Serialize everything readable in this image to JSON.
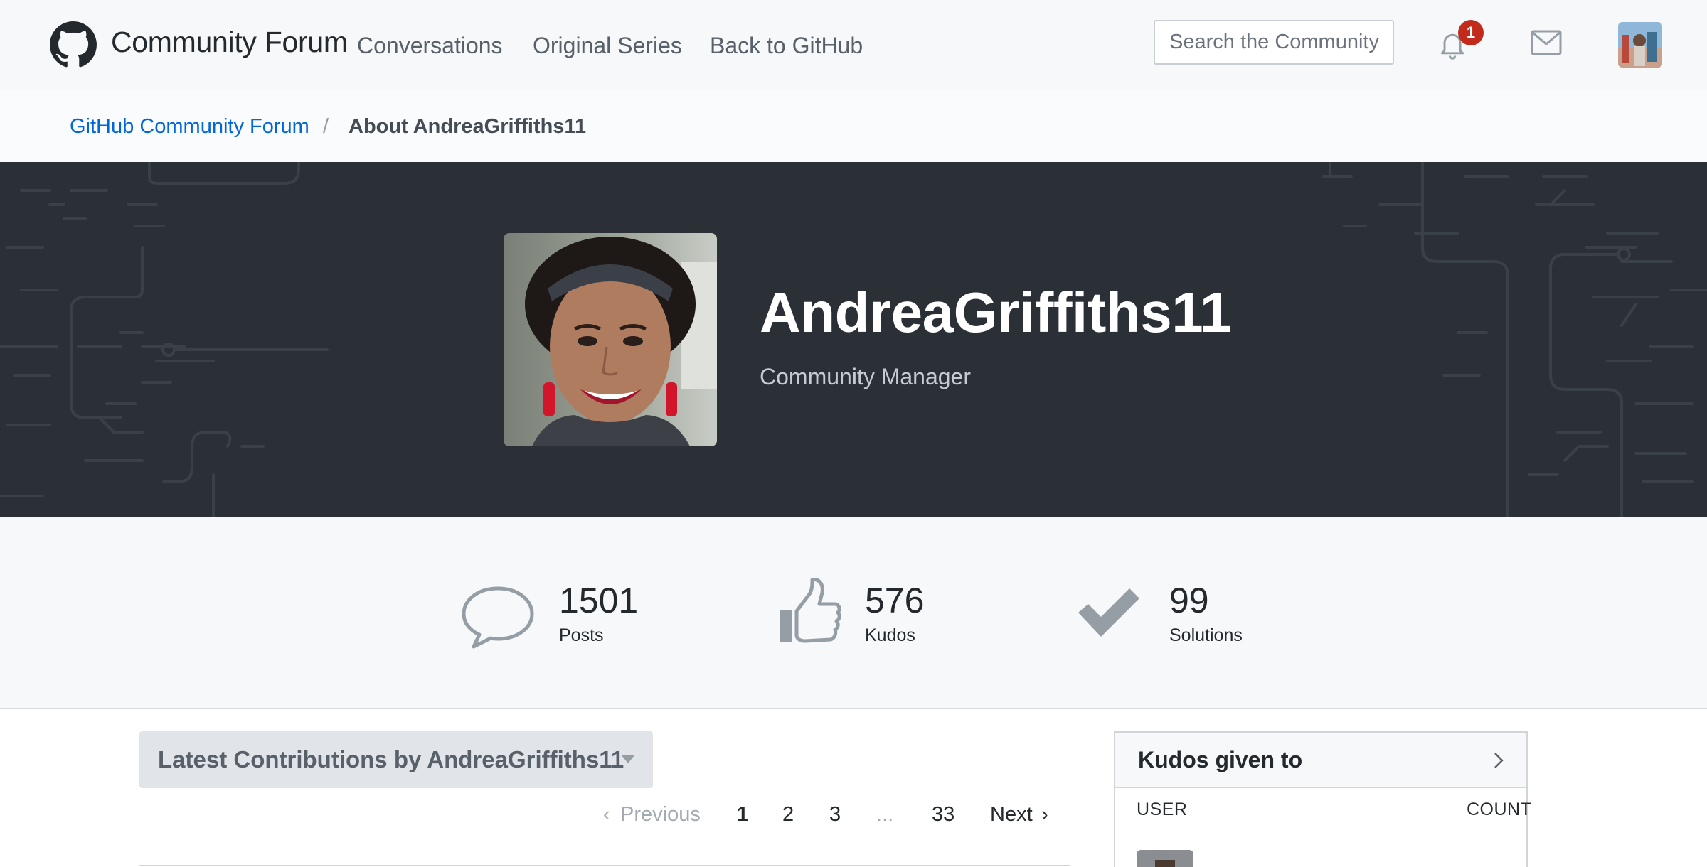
{
  "topnav": {
    "brand": "Community Forum",
    "links": [
      "Conversations",
      "Original Series",
      "Back to GitHub"
    ],
    "search_placeholder": "Search the Community",
    "notification_count": "1",
    "icons": {
      "logo": "github-octocat-icon",
      "bell": "bell-icon",
      "mail": "mail-icon"
    }
  },
  "breadcrumb": {
    "home": "GitHub Community Forum",
    "separator": "/",
    "current": "About AndreaGriffiths11"
  },
  "profile": {
    "username": "AndreaGriffiths11",
    "role": "Community Manager"
  },
  "stats": [
    {
      "value": "1501",
      "label": "Posts",
      "icon": "speech-bubble-icon"
    },
    {
      "value": "576",
      "label": "Kudos",
      "icon": "thumbs-up-icon"
    },
    {
      "value": "99",
      "label": "Solutions",
      "icon": "checkmark-icon"
    }
  ],
  "contributions": {
    "title": "Latest Contributions by AndreaGriffiths11",
    "pager": {
      "previous": "Previous",
      "pages": [
        "1",
        "2",
        "3"
      ],
      "ellipsis": "...",
      "last": "33",
      "next": "Next",
      "current": "1"
    }
  },
  "kudos_widget": {
    "title": "Kudos given to",
    "col_user": "USER",
    "col_count": "COUNT"
  },
  "colors": {
    "nav_bg": "#f6f8fa",
    "hero_bg": "#2b3036",
    "link": "#0366d6",
    "badge": "#c22b1b"
  }
}
